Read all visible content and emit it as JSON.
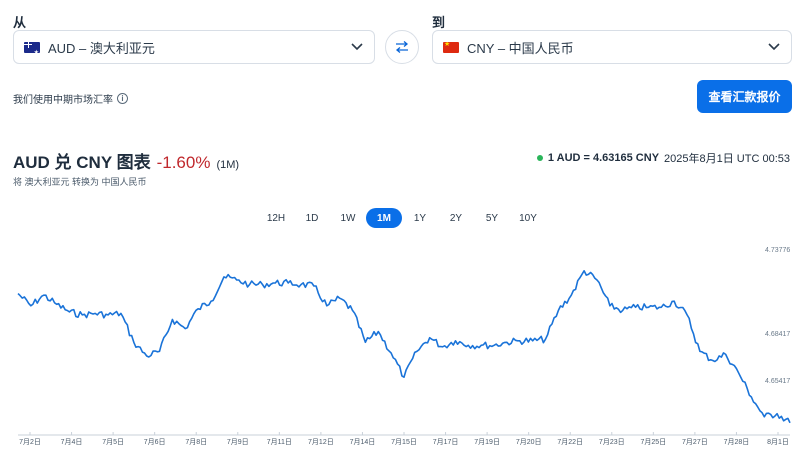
{
  "from": {
    "label": "从",
    "currency": "AUD – 澳大利亚元",
    "flag": "australia-flag"
  },
  "to": {
    "label": "到",
    "currency": "CNY – 中国人民币",
    "flag": "china-flag"
  },
  "swap_icon": "swap-arrows-icon",
  "mid_rate_note": "我们使用中期市场汇率",
  "send_button": "查看汇款报价",
  "chart_header": {
    "title": "AUD 兑 CNY 图表",
    "change": "-1.60%",
    "period": "(1M)",
    "subtitle": "将 澳大利亚元 转换为 中国人民币",
    "live_rate": "1 AUD = 4.63165 CNY",
    "timestamp": "2025年8月1日 UTC 00:53"
  },
  "range_tabs": [
    "12H",
    "1D",
    "1W",
    "1M",
    "1Y",
    "2Y",
    "5Y",
    "10Y"
  ],
  "active_tab": "1M",
  "colors": {
    "accent": "#0a6fe8",
    "line": "#1a73d8",
    "negative": "#c0282d",
    "live_dot": "#2ab55a"
  },
  "chart_data": {
    "type": "line",
    "title": "AUD 兑 CNY 图表",
    "y_ticks": [
      "4.73776",
      "4.68417",
      "4.65417"
    ],
    "x_ticks": [
      "7月2日",
      "7月4日",
      "7月5日",
      "7月6日",
      "7月8日",
      "7月9日",
      "7月11日",
      "7月12日",
      "7月14日",
      "7月15日",
      "7月17日",
      "7月19日",
      "7月20日",
      "7月22日",
      "7月23日",
      "7月25日",
      "7月27日",
      "7月28日",
      "8月1日"
    ],
    "ylim": [
      4.62,
      4.745
    ],
    "x": [
      0,
      0.5,
      1,
      1.5,
      2,
      2.5,
      3,
      3.5,
      4,
      4.5,
      5,
      5.5,
      6,
      6.5,
      7,
      7.5,
      8,
      8.5,
      9,
      9.5,
      10,
      10.5,
      11,
      11.5,
      12,
      12.5,
      13,
      13.5,
      14,
      14.5,
      15,
      15.5,
      16,
      16.5,
      17,
      17.5,
      18,
      18.5,
      19,
      19.5,
      20,
      20.5,
      21,
      21.5,
      22,
      22.5,
      23,
      23.5,
      24,
      24.5,
      25,
      25.5,
      26,
      26.5,
      27,
      27.5,
      28,
      28.5,
      29,
      29.5,
      30
    ],
    "values": [
      4.713,
      4.705,
      4.712,
      4.706,
      4.701,
      4.699,
      4.7,
      4.699,
      4.7,
      4.681,
      4.672,
      4.675,
      4.696,
      4.69,
      4.703,
      4.708,
      4.724,
      4.722,
      4.719,
      4.719,
      4.72,
      4.72,
      4.719,
      4.718,
      4.705,
      4.71,
      4.702,
      4.681,
      4.688,
      4.674,
      4.658,
      4.675,
      4.684,
      4.678,
      4.682,
      4.679,
      4.679,
      4.679,
      4.681,
      4.682,
      4.682,
      4.683,
      4.702,
      4.712,
      4.728,
      4.722,
      4.705,
      4.702,
      4.704,
      4.704,
      4.704,
      4.708,
      4.699,
      4.675,
      4.669,
      4.673,
      4.661,
      4.645,
      4.632,
      4.634,
      4.628
    ]
  }
}
